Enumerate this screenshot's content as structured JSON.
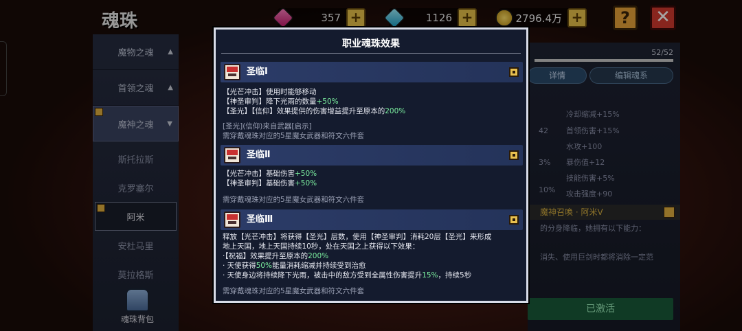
{
  "header": {
    "title": "魂珠",
    "resources": [
      {
        "icon": "pink-gem-icon",
        "value": "357"
      },
      {
        "icon": "cyan-diamond-icon",
        "value": "1126"
      },
      {
        "icon": "gold-coin-icon",
        "value": "2796.4万"
      }
    ],
    "plus": "+",
    "help": "?",
    "close": "✕"
  },
  "sidebar": {
    "categories": [
      {
        "label": "魔物之魂",
        "arrow": "▲"
      },
      {
        "label": "首领之魂",
        "arrow": "▲"
      },
      {
        "label": "魔神之魂",
        "arrow": "▼"
      }
    ],
    "subitems": [
      "斯托拉斯",
      "克罗塞尔",
      "阿米",
      "安杜马里",
      "莫拉格斯"
    ],
    "bag_label": "魂珠背包"
  },
  "right_panel": {
    "count": "52/52",
    "tabs": [
      "详情",
      "编辑魂系"
    ],
    "stats_left": [
      "42",
      "3%",
      "10%"
    ],
    "stats_right": [
      "冷却缩减+15%",
      "首领伤害+15%",
      "水攻+100",
      "暴伤值+12",
      "技能伤害+5%",
      "攻击强度+90"
    ],
    "boss_title": "魔神召唤 · 阿米Ⅴ",
    "desc_lines": [
      "的分身降临，她拥有以下能力：",
      "消失、使用巨剑时都将消除一定范"
    ],
    "activated": "已激活"
  },
  "modal": {
    "title": "职业魂珠效果",
    "skills": [
      {
        "name": "圣临Ⅰ",
        "lines": [
          {
            "text": "【光芒冲击】使用时能够移动",
            "hl": ""
          },
          {
            "text": "【神圣审判】降下光雨的数量",
            "hl": "+50%"
          },
          {
            "text": "【圣光】【信仰】效果提供的伤害增益提升至原本的",
            "hl": "200%"
          }
        ],
        "note": "[圣光](信仰)来自武器[启示]",
        "requirement": "需穿戴魂珠对应的5星魔女武器和符文六件套"
      },
      {
        "name": "圣临Ⅱ",
        "lines": [
          {
            "text": "【光芒冲击】基础伤害",
            "hl": "+50%"
          },
          {
            "text": "【神圣审判】基础伤害",
            "hl": "+50%"
          }
        ],
        "requirement": "需穿戴魂珠对应的5星魔女武器和符文六件套"
      },
      {
        "name": "圣临Ⅲ",
        "intro": [
          "释放【光芒冲击】将获得【圣光】层数，使用【神圣审判】消耗20层【圣光】来形成",
          "地上天国，地上天国持续10秒，处在天国之上获得以下效果："
        ],
        "b1_pre": "·【祝福】效果提升至原本的",
        "b1_hl": "200%",
        "b2_pre": "· 天使获得",
        "b2_hl": "50%",
        "b2_post": "能量消耗缩减并持续受到治愈",
        "b3_pre": "· 天使身边将持续降下光雨，被击中的敌方受到全属性伤害提升",
        "b3_hl": "15%",
        "b3_post": "，持续5秒",
        "requirement": "需穿戴魂珠对应的5星魔女武器和符文六件套"
      }
    ]
  }
}
